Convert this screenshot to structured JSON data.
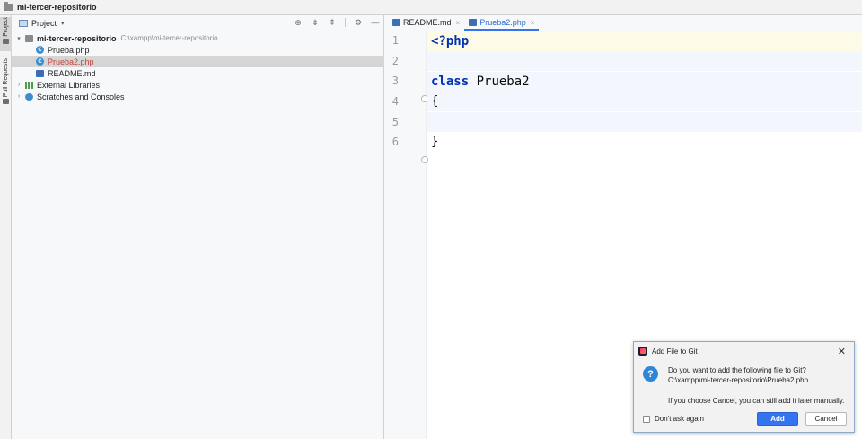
{
  "window": {
    "title": "mi-tercer-repositorio"
  },
  "leftstrip": {
    "tabs": [
      "Project",
      "Pull Requests"
    ]
  },
  "project": {
    "header": {
      "label": "Project",
      "caret": "▾"
    },
    "tools": {
      "locate": "⊕",
      "expand": "⇟",
      "collapse": "⇞",
      "settings": "⚙",
      "hide": "—"
    },
    "tree": [
      {
        "label": "mi-tercer-repositorio",
        "path": "C:\\xampp\\mi-tercer-repositorio",
        "arrow": "▾"
      },
      {
        "label": "Prueba.php"
      },
      {
        "label": "Prueba2.php"
      },
      {
        "label": "README.md"
      },
      {
        "label": "External Libraries",
        "arrow": "›"
      },
      {
        "label": "Scratches and Consoles",
        "arrow": "›"
      }
    ],
    "php_icon_letter": "C"
  },
  "editor": {
    "tabs": [
      {
        "label": "README.md",
        "close": "×"
      },
      {
        "label": "Prueba2.php",
        "close": "×"
      }
    ],
    "line_numbers": [
      "1",
      "2",
      "3",
      "4",
      "5",
      "6"
    ],
    "code": {
      "l1": "<?php",
      "l3_kw": "class",
      "l3_id": " Prueba2",
      "l4": "{",
      "l6": "}"
    }
  },
  "dialog": {
    "title": "Add File to Git",
    "close": "✕",
    "question_icon": "?",
    "message_line1": "Do you want to add the following file to Git?",
    "message_line2": "C:\\xampp\\mi-tercer-repositorio\\Prueba2.php",
    "note": "If you choose Cancel, you can still add it later manually.",
    "checkbox_label": "Don't ask again",
    "add_label": "Add",
    "cancel_label": "Cancel"
  },
  "colors": {
    "accent": "#3574f0",
    "modified_file": "#c6443b",
    "keyword": "#0033b3",
    "current_line": "#fdfbe8"
  }
}
